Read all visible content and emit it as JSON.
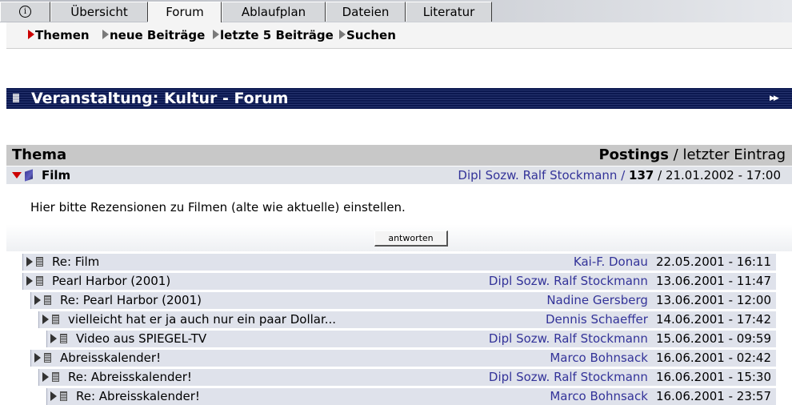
{
  "tabs": [
    {
      "id": "info",
      "label": "i"
    },
    {
      "id": "uebersicht",
      "label": "Übersicht"
    },
    {
      "id": "forum",
      "label": "Forum"
    },
    {
      "id": "ablaufplan",
      "label": "Ablaufplan"
    },
    {
      "id": "dateien",
      "label": "Dateien"
    },
    {
      "id": "literatur",
      "label": "Literatur"
    }
  ],
  "active_tab": "forum",
  "subnav": [
    {
      "label": "Themen",
      "active": true
    },
    {
      "label": "neue Beiträge",
      "active": false
    },
    {
      "label": "letzte 5 Beiträge",
      "active": false
    },
    {
      "label": "Suchen",
      "active": false
    }
  ],
  "page_title": "Veranstaltung: Kultur - Forum",
  "header": {
    "thema": "Thema",
    "postings": "Postings",
    "separator": " / ",
    "letzter_eintrag": "letzter Eintrag"
  },
  "topic": {
    "title": "Film",
    "author": "Dipl Sozw. Ralf Stockmann",
    "meta_sep": " / ",
    "postings": "137",
    "date_sep": " / ",
    "last_entry": "21.01.2002 - 17:00",
    "description": "Hier bitte Rezensionen zu Filmen (alte wie aktuelle) einstellen.",
    "reply_button": "antworten"
  },
  "replies": [
    {
      "level": 0,
      "title": "Re: Film",
      "author": "Kai-F. Donau",
      "date": "22.05.2001 - 16:11"
    },
    {
      "level": 0,
      "title": "Pearl Harbor (2001)",
      "author": "Dipl Sozw. Ralf Stockmann",
      "date": "13.06.2001 - 11:47"
    },
    {
      "level": 1,
      "title": "Re: Pearl Harbor (2001)",
      "author": "Nadine Gersberg",
      "date": "13.06.2001 - 12:00"
    },
    {
      "level": 2,
      "title": "vielleicht hat er ja auch nur ein paar Dollar...",
      "author": "Dennis Schaeffer",
      "date": "14.06.2001 - 17:42"
    },
    {
      "level": 3,
      "title": "Video aus SPIEGEL-TV",
      "author": "Dipl Sozw. Ralf Stockmann",
      "date": "15.06.2001 - 09:59"
    },
    {
      "level": 1,
      "title": "Abreisskalender!",
      "author": "Marco Bohnsack",
      "date": "16.06.2001 - 02:42"
    },
    {
      "level": 2,
      "title": "Re: Abreisskalender!",
      "author": "Dipl Sozw. Ralf Stockmann",
      "date": "16.06.2001 - 15:30"
    },
    {
      "level": 3,
      "title": "Re: Abreisskalender!",
      "author": "Marco Bohnsack",
      "date": "16.06.2001 - 23:57"
    }
  ]
}
